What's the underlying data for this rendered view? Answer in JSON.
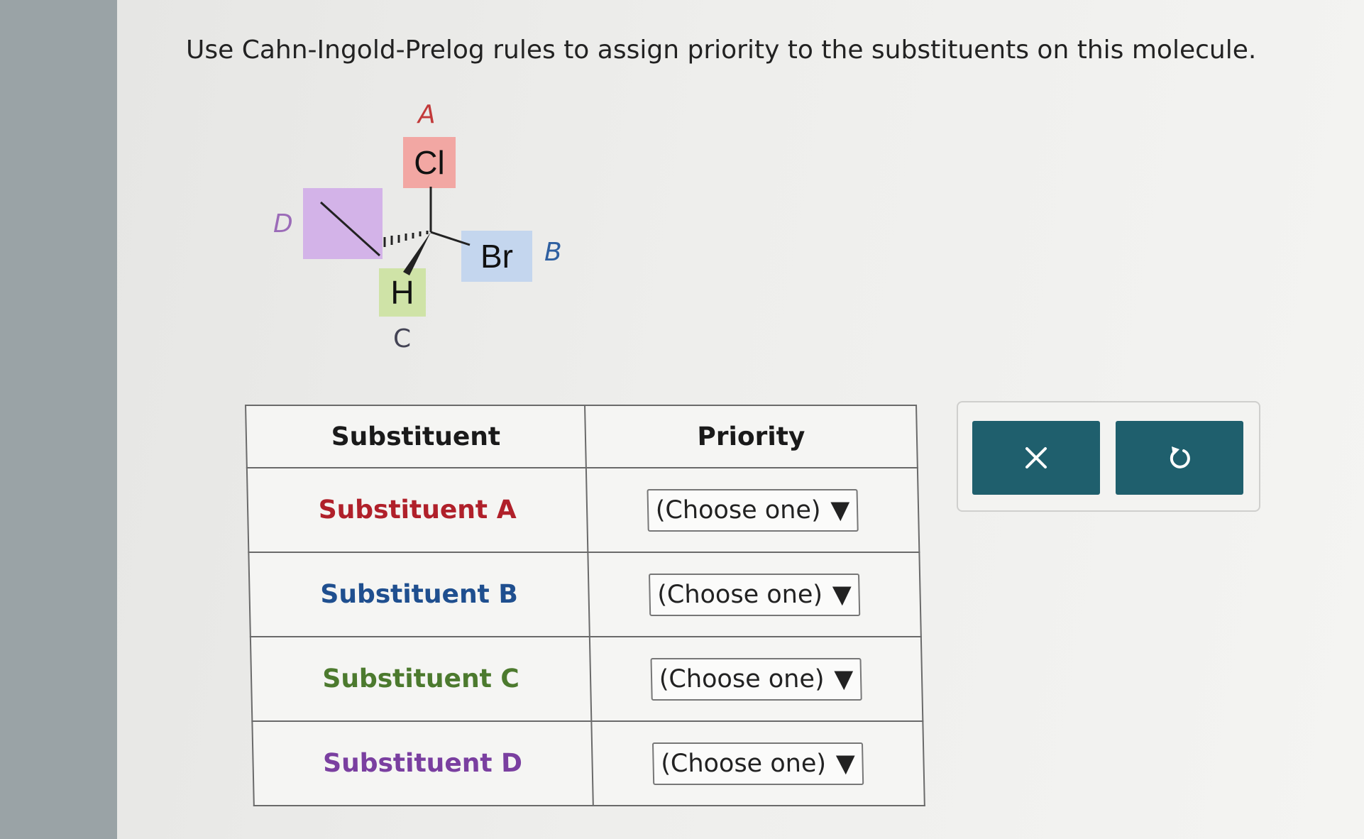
{
  "question": "Use Cahn-Ingold-Prelog rules to assign priority to the substituents on this molecule.",
  "molecule": {
    "labels": {
      "a": "A",
      "b": "B",
      "c": "C",
      "d": "D"
    },
    "atoms": {
      "cl": "Cl",
      "br": "Br",
      "h": "H"
    }
  },
  "table": {
    "headers": {
      "substituent": "Substituent",
      "priority": "Priority"
    },
    "rows": [
      {
        "name": "Substituent A",
        "select": "(Choose one)",
        "color": "#b0202a"
      },
      {
        "name": "Substituent B",
        "select": "(Choose one)",
        "color": "#1f4f8f"
      },
      {
        "name": "Substituent C",
        "select": "(Choose one)",
        "color": "#4c7a2e"
      },
      {
        "name": "Substituent D",
        "select": "(Choose one)",
        "color": "#7a3fa0"
      }
    ],
    "arrow": "▼"
  },
  "buttons": {
    "clear_icon": "close-icon",
    "undo_icon": "undo-icon",
    "color": "#1f5f6d"
  },
  "colors": {
    "cl_box": "#f2a7a3",
    "br_box": "#c4d6ee",
    "h_box": "#cfe3a7",
    "d_box": "#d3b3e8"
  }
}
